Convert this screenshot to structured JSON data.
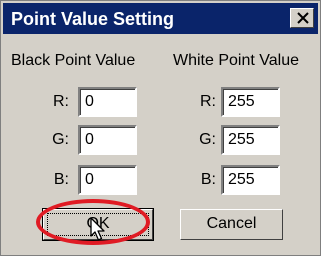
{
  "dialog": {
    "title": "Point Value Setting",
    "close_symbol": "×",
    "black": {
      "heading": "Black Point Value",
      "rows": [
        {
          "label": "R:",
          "value": "0"
        },
        {
          "label": "G:",
          "value": "0"
        },
        {
          "label": "B:",
          "value": "0"
        }
      ]
    },
    "white": {
      "heading": "White Point Value",
      "rows": [
        {
          "label": "R:",
          "value": "255"
        },
        {
          "label": "G:",
          "value": "255"
        },
        {
          "label": "B:",
          "value": "255"
        }
      ]
    },
    "ok_label": "OK",
    "cancel_label": "Cancel"
  },
  "colors": {
    "titlebar": "#0a246a",
    "dialog_bg": "#d4d0c8",
    "highlight": "#e01b24"
  },
  "icons": [
    "close-icon",
    "mouse-pointer-icon"
  ]
}
